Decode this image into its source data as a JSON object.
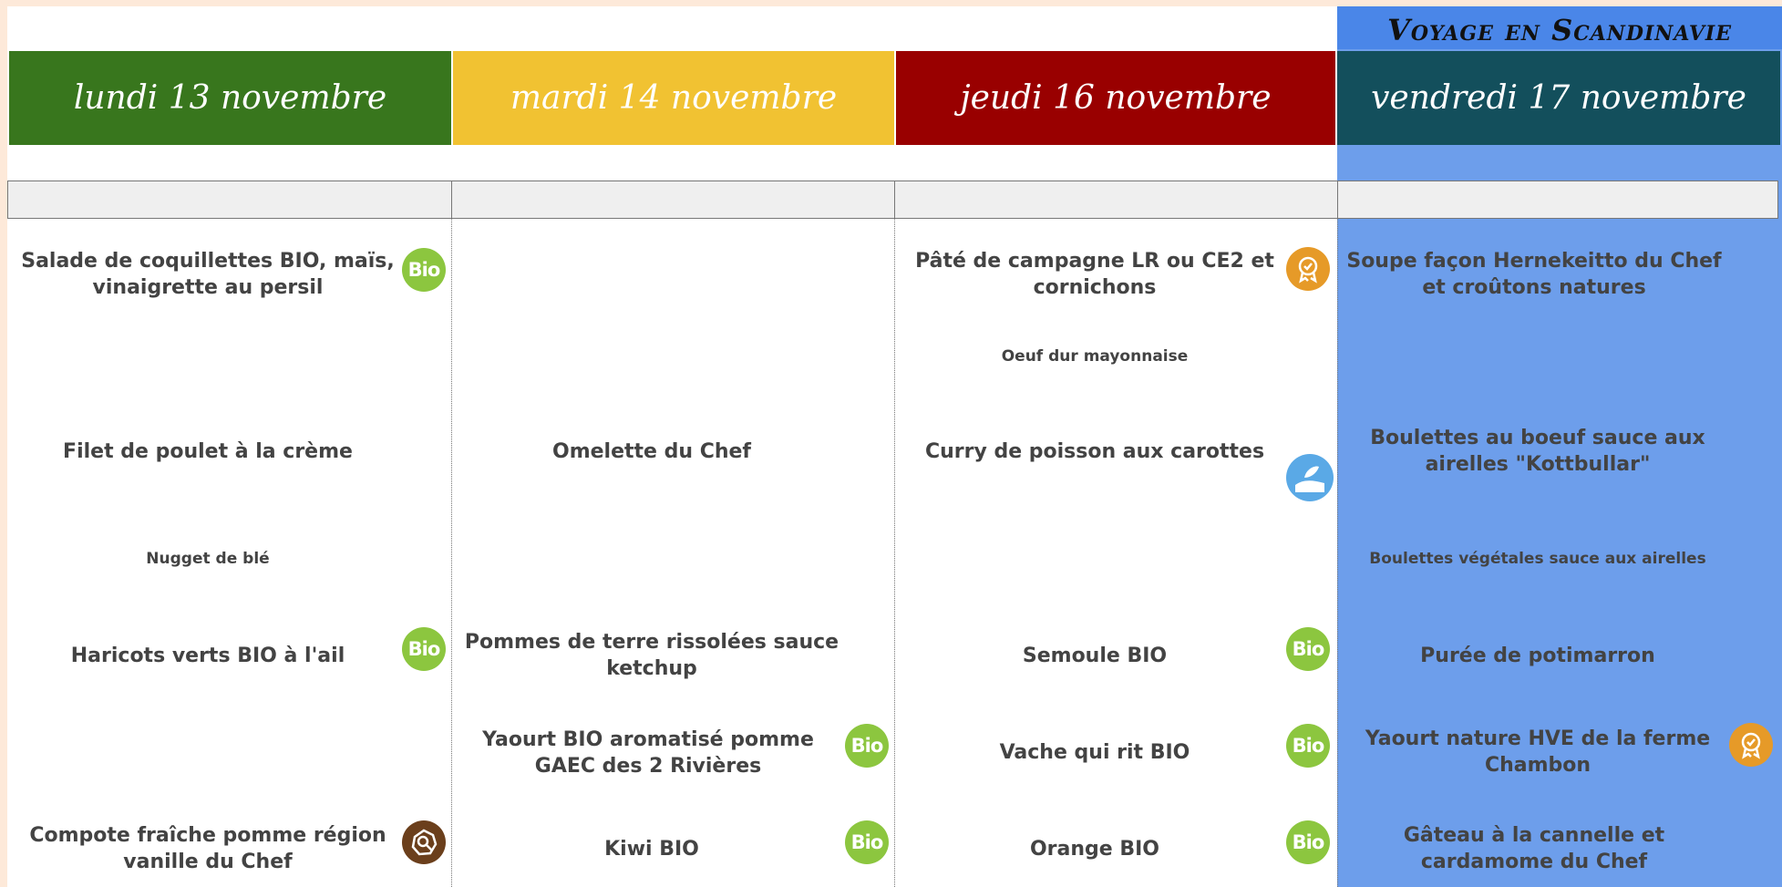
{
  "theme": {
    "title": "Voyage en Scandinavie"
  },
  "days": [
    {
      "label": "lundi 13 novembre",
      "color": "#38761d"
    },
    {
      "label": "mardi 14 novembre",
      "color": "#f1c232"
    },
    {
      "label": "jeudi 16 novembre",
      "color": "#990000"
    },
    {
      "label": "vendredi 17 novembre",
      "color": "#134f5c"
    }
  ],
  "badges": {
    "bio_text": "Bio",
    "bio_icon": "bio-badge-icon",
    "label_icon": "quality-label-icon",
    "fish_icon": "sustainable-fishing-icon",
    "region_icon": "local-region-icon"
  },
  "menu": {
    "mon": {
      "starter": "Salade de coquillettes BIO, maïs, vinaigrette au persil",
      "main": "Filet de poulet à la crème",
      "main_alt": "Nugget de blé",
      "side": "Haricots verts BIO à l'ail",
      "dessert": "Compote fraîche pomme région vanille du Chef"
    },
    "tue": {
      "main": "Omelette du Chef",
      "side": "Pommes de terre rissolées sauce ketchup",
      "dairy": "Yaourt BIO aromatisé pomme GAEC des 2 Rivières",
      "dessert": "Kiwi BIO"
    },
    "thu": {
      "starter": "Pâté de campagne LR ou CE2 et cornichons",
      "starter_alt": "Oeuf dur mayonnaise",
      "main": "Curry de poisson aux carottes",
      "side": "Semoule BIO",
      "dairy": "Vache qui rit BIO",
      "dessert": "Orange BIO"
    },
    "fri": {
      "starter": "Soupe façon Hernekeitto du Chef et croûtons natures",
      "main": "Boulettes au boeuf sauce aux airelles \"Kottbullar\"",
      "main_alt": "Boulettes végétales sauce aux airelles",
      "side": "Purée de potimarron",
      "dairy": "Yaourt nature HVE de la ferme Chambon",
      "dessert": "Gâteau à la cannelle et cardamome du Chef"
    }
  }
}
